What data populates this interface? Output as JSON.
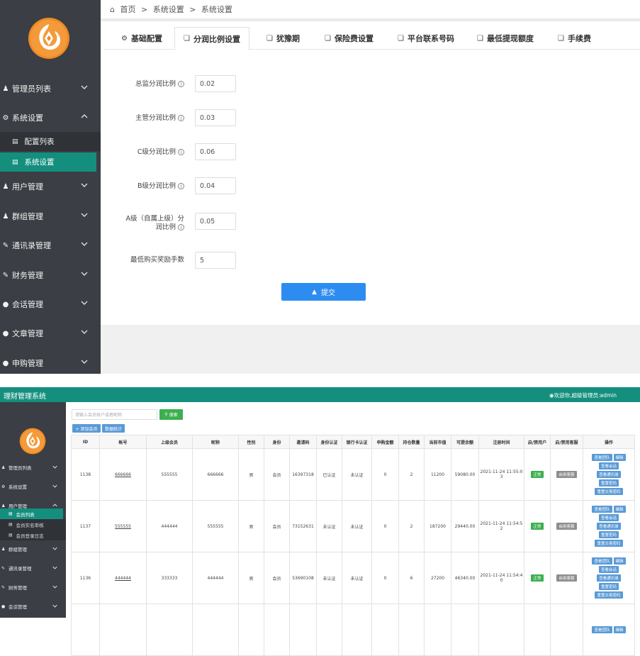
{
  "top": {
    "breadcrumb": [
      "首页",
      ">",
      "系统设置",
      ">",
      "系统设置"
    ],
    "sidebar": [
      {
        "label": "管理员列表",
        "icon": "user-icon",
        "state": "collapsed"
      },
      {
        "label": "系统设置",
        "icon": "gear-icon",
        "state": "expanded"
      },
      {
        "label": "用户管理",
        "icon": "user-icon",
        "state": "collapsed"
      },
      {
        "label": "群组管理",
        "icon": "group-icon",
        "state": "collapsed"
      },
      {
        "label": "通讯录管理",
        "icon": "edit-icon",
        "state": "collapsed"
      },
      {
        "label": "财务管理",
        "icon": "edit-icon",
        "state": "collapsed"
      },
      {
        "label": "会话管理",
        "icon": "chat-icon",
        "state": "collapsed"
      },
      {
        "label": "文章管理",
        "icon": "chat-icon",
        "state": "collapsed"
      },
      {
        "label": "申购管理",
        "icon": "chat-icon",
        "state": "collapsed"
      }
    ],
    "sub_items": [
      "配置列表",
      "系统设置"
    ],
    "tabs": [
      "基础配置",
      "分润比例设置",
      "犹豫期",
      "保险费设置",
      "平台联系号码",
      "最低提现额度",
      "手续费"
    ],
    "active_tab": "分润比例设置",
    "form": [
      {
        "label": "总监分润比例",
        "value": "0.02",
        "info": true
      },
      {
        "label": "主管分润比例",
        "value": "0.03",
        "info": true
      },
      {
        "label": "C级分润比例",
        "value": "0.06",
        "info": true
      },
      {
        "label": "B级分润比例",
        "value": "0.04",
        "info": true
      },
      {
        "label_line1": "A级（自属上级）分",
        "label_line2": "润比例",
        "value": "0.05",
        "info": true
      },
      {
        "label": "最低购买奖励手数",
        "value": "5",
        "info": false
      }
    ],
    "submit_label": "提交"
  },
  "bottom": {
    "app_title": "理财管理系统",
    "welcome": "欢迎你,超级管理员:admin",
    "sidebar": [
      {
        "label": "管理员列表",
        "icon": "user-icon",
        "state": "collapsed"
      },
      {
        "label": "系统设置",
        "icon": "gear-icon",
        "state": "collapsed"
      },
      {
        "label": "用户管理",
        "icon": "user-icon",
        "state": "expanded"
      },
      {
        "label": "群组管理",
        "icon": "group-icon",
        "state": "collapsed"
      },
      {
        "label": "通讯录管理",
        "icon": "edit-icon",
        "state": "collapsed"
      },
      {
        "label": "财务管理",
        "icon": "edit-icon",
        "state": "collapsed"
      },
      {
        "label": "会话管理",
        "icon": "chat-icon",
        "state": "collapsed"
      }
    ],
    "sub_items": [
      "会员列表",
      "会员实名审核",
      "会员登录日志"
    ],
    "search_placeholder": "请输入会员账户或者昵称",
    "search_button": "搜索",
    "add_button": "添加会员",
    "stats_button": "数据统计",
    "columns": [
      "ID",
      "帐号",
      "上级会员",
      "昵称",
      "性别",
      "身份",
      "邀请码",
      "身份认证",
      "银行卡认证",
      "申购金额",
      "持仓数量",
      "当前市值",
      "可提余额",
      "注册时间",
      "启/禁用户",
      "启/禁用客服",
      "操作"
    ],
    "rows": [
      {
        "id": "1138",
        "account": "666666",
        "parent": "555555",
        "nickname": "666666",
        "gender": "男",
        "role": "会员",
        "invite": "16397318",
        "id_auth": "已认证",
        "bank_auth": "未认证",
        "amount": "0",
        "holdings": "2",
        "market": "11200",
        "balance": "59080.00",
        "reg_line1": "2021-11-24 11:55:0",
        "reg_line2": "3",
        "user_status": "正常",
        "cs_status": "启用客服"
      },
      {
        "id": "1137",
        "account": "555555",
        "parent": "444444",
        "nickname": "555555",
        "gender": "男",
        "role": "会员",
        "invite": "73152631",
        "id_auth": "未认证",
        "bank_auth": "未认证",
        "amount": "0",
        "holdings": "2",
        "market": "187200",
        "balance": "29440.00",
        "reg_line1": "2021-11-24 11:54:5",
        "reg_line2": "2",
        "user_status": "正常",
        "cs_status": "启用客服"
      },
      {
        "id": "1136",
        "account": "444444",
        "parent": "333333",
        "nickname": "444444",
        "gender": "男",
        "role": "会员",
        "invite": "53690108",
        "id_auth": "未认证",
        "bank_auth": "未认证",
        "amount": "0",
        "holdings": "6",
        "market": "27200",
        "balance": "46340.00",
        "reg_line1": "2021-11-24 11:54:4",
        "reg_line2": "0",
        "user_status": "正常",
        "cs_status": "启用客服"
      }
    ],
    "ops": [
      "查看团队",
      "编辑",
      "查看会话",
      "查看通讯录",
      "重置密码",
      "重置交易密码"
    ]
  }
}
